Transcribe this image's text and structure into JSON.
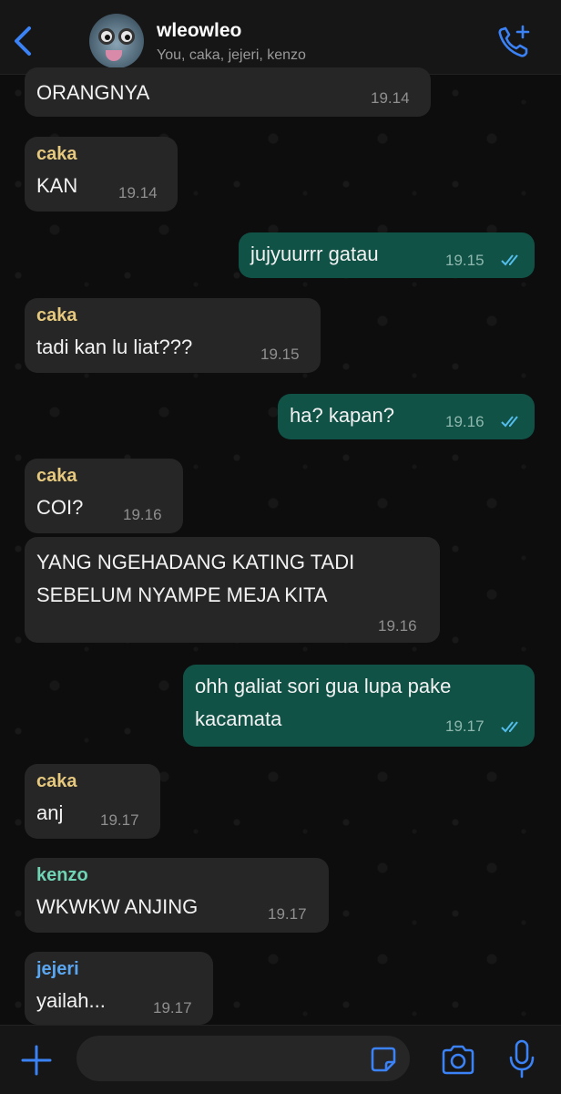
{
  "header": {
    "title": "wleowleo",
    "participants": "You, caka, jejeri, kenzo"
  },
  "colors": {
    "accent": "#3b82f6",
    "out_bubble": "#115247",
    "in_bubble": "#262626",
    "caka": "#e6c97e",
    "kenzo": "#6fd3b4",
    "jejeri": "#5aa6f0",
    "read_tick": "#53bdeb"
  },
  "messages": [
    {
      "sender": "",
      "text": "ORANGNYA",
      "time": "19.14"
    },
    {
      "sender": "caka",
      "text": "KAN",
      "time": "19.14"
    },
    {
      "sender": "",
      "text": "jujyuurrr gatau",
      "time": "19.15"
    },
    {
      "sender": "caka",
      "text": "tadi kan lu liat???",
      "time": "19.15"
    },
    {
      "sender": "",
      "text": "ha? kapan?",
      "time": "19.16"
    },
    {
      "sender": "caka",
      "text": "COI?",
      "time": "19.16"
    },
    {
      "sender": "",
      "text": "YANG NGEHADANG KATING TADI\nSEBELUM NYAMPE MEJA KITA",
      "time": "19.16"
    },
    {
      "sender": "",
      "text": "ohh galiat sori gua lupa pake\nkacamata",
      "time": "19.17"
    },
    {
      "sender": "caka",
      "text": "anj",
      "time": "19.17"
    },
    {
      "sender": "kenzo",
      "text": "WKWKW ANJING",
      "time": "19.17"
    },
    {
      "sender": "jejeri",
      "text": "yailah...",
      "time": "19.17"
    }
  ],
  "composer": {
    "value": ""
  }
}
